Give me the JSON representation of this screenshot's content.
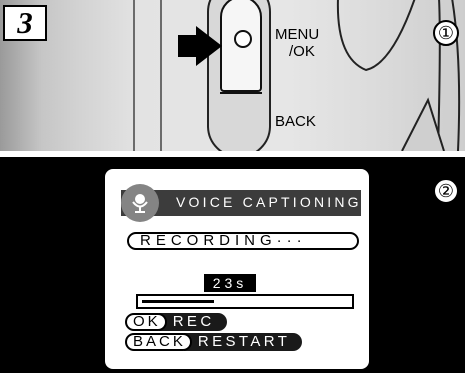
{
  "step": {
    "number": "3"
  },
  "camera": {
    "menu_ok_line1": "MENU",
    "menu_ok_line2": "/OK",
    "back_label": "BACK",
    "callout_1": "①",
    "callout_2": "②"
  },
  "screen": {
    "title": "VOICE CAPTIONING",
    "status": "RECORDING···",
    "elapsed": "23s",
    "progress_fraction": 0.35,
    "controls": [
      {
        "key": "OK",
        "action": "REC"
      },
      {
        "key": "BACK",
        "action": "RESTART"
      }
    ]
  },
  "icons": {
    "arrow": "right-arrow-icon",
    "mic": "microphone-icon"
  },
  "colors": {
    "lcd_header": "#3c3c3c",
    "mic_badge": "#848484",
    "background": "#000000"
  }
}
